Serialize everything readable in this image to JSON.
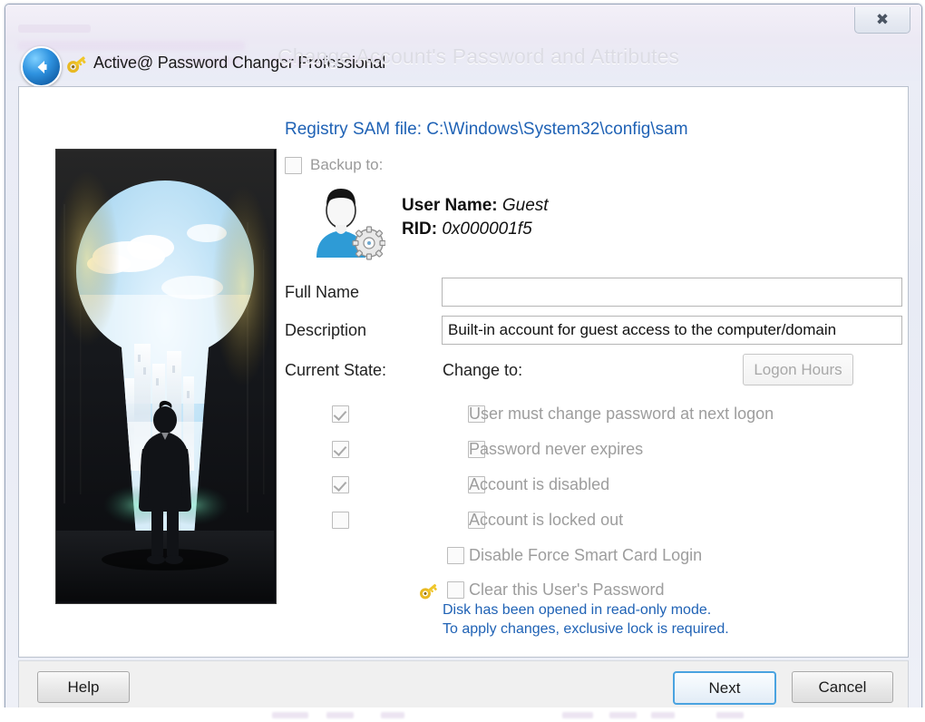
{
  "window": {
    "app_title": "Active@ Password Changer Professional",
    "page_title": "Change Account's Password and Attributes",
    "close_label": "✕",
    "back_icon": "back-arrow-icon",
    "app_icon": "key-icon"
  },
  "content": {
    "sam_file_line": "Registry SAM file: C:\\Windows\\System32\\config\\sam",
    "backup_to_label": "Backup to:",
    "backup_to_checked": false,
    "picture_alt": "keyhole-doorway-businessman-image",
    "user": {
      "name_label": "User Name:",
      "name_value": "Guest",
      "rid_label": "RID:",
      "rid_value": "0x000001f5"
    },
    "fields": {
      "full_name_label": "Full Name",
      "full_name_value": "",
      "full_name_placeholder": "",
      "description_label": "Description",
      "description_value": "Built-in account for guest access to the computer/domain",
      "description_placeholder": ""
    },
    "columns": {
      "current_state_label": "Current State:",
      "change_to_label": "Change to:"
    },
    "logon_hours_label": "Logon Hours",
    "attributes": [
      {
        "label": "User must change password at next logon",
        "current_state": true,
        "has_state_box": true,
        "change_to": false,
        "icon": null
      },
      {
        "label": "Password never expires",
        "current_state": true,
        "has_state_box": true,
        "change_to": false,
        "icon": null
      },
      {
        "label": "Account is disabled",
        "current_state": true,
        "has_state_box": true,
        "change_to": false,
        "icon": null
      },
      {
        "label": "Account is locked out",
        "current_state": false,
        "has_state_box": true,
        "change_to": false,
        "icon": null
      },
      {
        "label": "Disable Force Smart Card Login",
        "current_state": false,
        "has_state_box": false,
        "change_to": false,
        "icon": null
      },
      {
        "label": "Clear this User's Password",
        "current_state": false,
        "has_state_box": false,
        "change_to": false,
        "icon": "key-icon"
      }
    ],
    "warning_line_1": "Disk has been opened in read-only mode.",
    "warning_line_2": "To apply changes, exclusive lock is required."
  },
  "footer": {
    "help_label": "Help",
    "next_label": "Next",
    "cancel_label": "Cancel"
  },
  "colors": {
    "link_blue": "#1f62b5",
    "disabled_gray": "#9d9d9d",
    "accent_focus": "#4aa3e0",
    "titlebar": "#ece9f4"
  }
}
